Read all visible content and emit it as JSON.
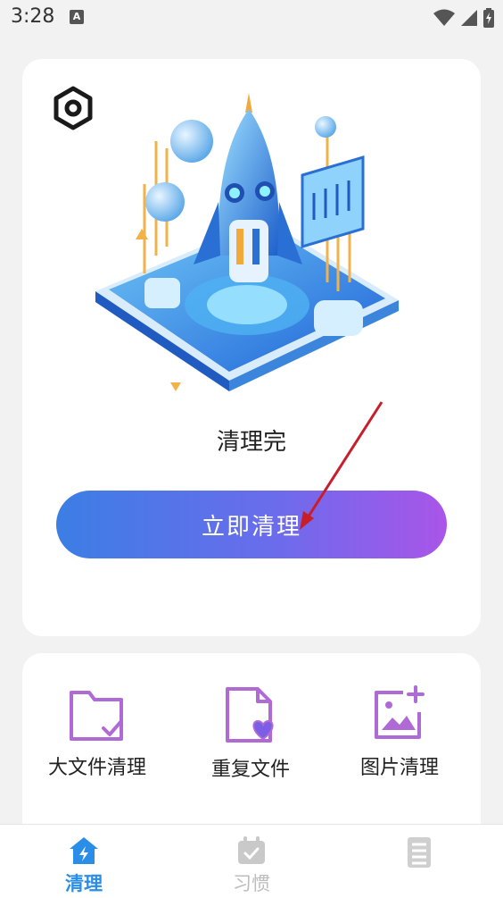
{
  "status_bar": {
    "time": "3:28",
    "notification_letter": "A"
  },
  "hero": {
    "status_text": "清理完",
    "clean_button_label": "立即清理"
  },
  "tools": [
    {
      "label": "大文件清理",
      "icon": "folder-check-icon"
    },
    {
      "label": "重复文件",
      "icon": "file-heart-icon"
    },
    {
      "label": "图片清理",
      "icon": "image-plus-icon"
    }
  ],
  "nav": {
    "items": [
      {
        "label": "清理",
        "icon": "home-bolt-icon",
        "active": true
      },
      {
        "label": "习惯",
        "icon": "calendar-check-icon",
        "active": false
      },
      {
        "label": "",
        "icon": "list-icon",
        "active": false
      }
    ]
  },
  "colors": {
    "accent": "#2a8ee8",
    "button_gradient_start": "#3c7ee4",
    "button_gradient_end": "#a955e8",
    "tool_icon": "#b06ad6",
    "annotation_arrow": "#c81e2a"
  }
}
